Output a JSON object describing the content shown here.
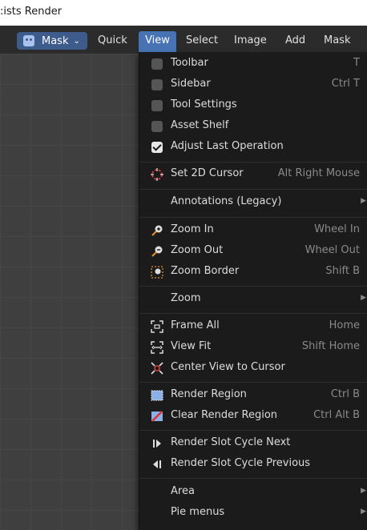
{
  "window": {
    "title": ":ists Render"
  },
  "header": {
    "editor_label": "Mask",
    "menus": [
      {
        "label": "Quick",
        "left": 0
      },
      {
        "label": "View"
      },
      {
        "label": "Select"
      },
      {
        "label": "Image"
      },
      {
        "label": "Add"
      },
      {
        "label": "Mask"
      }
    ]
  },
  "view_menu": {
    "toggles": [
      {
        "label": "Toolbar",
        "shortcut": "T",
        "checked": false
      },
      {
        "label": "Sidebar",
        "shortcut": "Ctrl T",
        "checked": false
      },
      {
        "label": "Tool Settings",
        "shortcut": "",
        "checked": false
      },
      {
        "label": "Asset Shelf",
        "shortcut": "",
        "checked": false
      },
      {
        "label": "Adjust Last Operation",
        "shortcut": "",
        "checked": true
      }
    ],
    "cursor": {
      "label": "Set 2D Cursor",
      "shortcut": "Alt Right Mouse"
    },
    "annotations": {
      "label": "Annotations (Legacy)"
    },
    "zoom_items": [
      {
        "label": "Zoom In",
        "shortcut": "Wheel In",
        "icon": "zoom-in-icon"
      },
      {
        "label": "Zoom Out",
        "shortcut": "Wheel Out",
        "icon": "zoom-out-icon"
      },
      {
        "label": "Zoom Border",
        "shortcut": "Shift B",
        "icon": "zoom-border-icon"
      }
    ],
    "zoom_submenu": {
      "label": "Zoom"
    },
    "view_items": [
      {
        "label": "Frame All",
        "shortcut": "Home",
        "icon": "frame-all-icon"
      },
      {
        "label": "View Fit",
        "shortcut": "Shift Home",
        "icon": "view-fit-icon"
      },
      {
        "label": "Center View to Cursor",
        "shortcut": "",
        "icon": "center-cursor-icon"
      }
    ],
    "render_region": [
      {
        "label": "Render Region",
        "shortcut": "Ctrl B",
        "icon": "render-region-icon"
      },
      {
        "label": "Clear Render Region",
        "shortcut": "Ctrl Alt B",
        "icon": "clear-render-region-icon"
      }
    ],
    "slots": [
      {
        "label": "Render Slot Cycle Next",
        "icon": "next-slot-icon"
      },
      {
        "label": "Render Slot Cycle Previous",
        "icon": "previous-slot-icon"
      }
    ],
    "submenus": [
      {
        "label": "Area"
      },
      {
        "label": "Pie menus"
      }
    ]
  },
  "colors": {
    "accent": "#4772b3",
    "editor_button": "#3d5c8c",
    "menu_bg": "#1b1b1b",
    "header_bg": "#2b2b2b"
  }
}
